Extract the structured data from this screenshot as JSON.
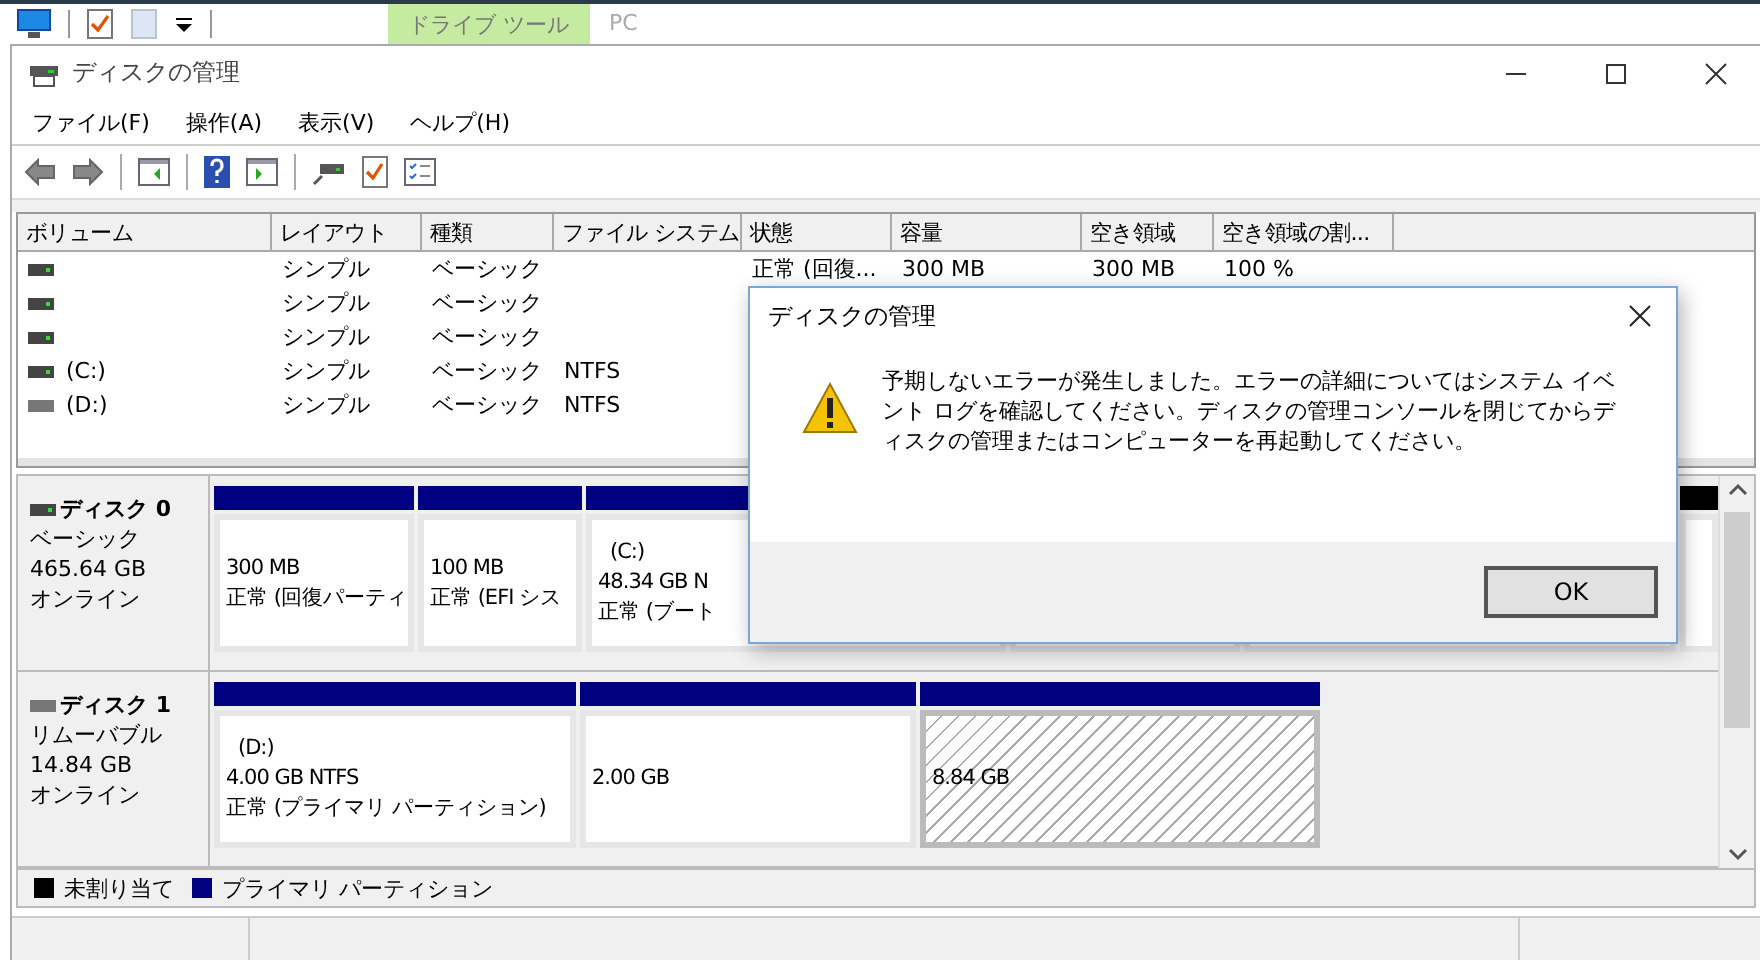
{
  "explorer_ribbon": {
    "tabs": [
      {
        "label": "ドライブ ツール",
        "selected": true
      },
      {
        "label": "PC",
        "selected": false
      }
    ]
  },
  "window": {
    "title": "ディスクの管理"
  },
  "menu": [
    "ファイル(F)",
    "操作(A)",
    "表示(V)",
    "ヘルプ(H)"
  ],
  "volume_table": {
    "columns": [
      "ボリューム",
      "レイアウト",
      "種類",
      "ファイル システム",
      "状態",
      "容量",
      "空き領域",
      "空き領域の割..."
    ],
    "rows": [
      {
        "led": true,
        "cells": [
          "",
          "シンプル",
          "ベーシック",
          "",
          "正常 (回復...",
          "300 MB",
          "300 MB",
          "100 %"
        ]
      },
      {
        "led": true,
        "cells": [
          "",
          "シンプル",
          "ベーシック"
        ]
      },
      {
        "led": true,
        "cells": [
          "",
          "シンプル",
          "ベーシック"
        ]
      },
      {
        "led": true,
        "cells": [
          "(C:)",
          "シンプル",
          "ベーシック",
          "NTFS"
        ]
      },
      {
        "led": false,
        "cells": [
          "(D:)",
          "シンプル",
          "ベーシック",
          "NTFS"
        ]
      }
    ]
  },
  "disks": [
    {
      "name": "ディスク 0",
      "led": true,
      "type": "ベーシック",
      "size": "465.64 GB",
      "status": "オンライン",
      "partitions": [
        {
          "kind": "primary",
          "selected": false,
          "size": "300 MB",
          "status": "正常 (回復パーティ"
        },
        {
          "kind": "primary",
          "selected": false,
          "size": "100 MB",
          "status": "正常 (EFI シス"
        },
        {
          "kind": "primary",
          "selected": false,
          "label": "(C:)",
          "size": "48.34 GB N",
          "status": "正常 (ブート"
        },
        {
          "selected": false
        },
        {
          "selected": false
        },
        {
          "kind": "unallocated",
          "selected": false
        }
      ]
    },
    {
      "name": "ディスク 1",
      "led": false,
      "type": "リムーバブル",
      "size": "14.84 GB",
      "status": "オンライン",
      "partitions": [
        {
          "kind": "primary",
          "selected": false,
          "label": "(D:)",
          "size": "4.00 GB NTFS",
          "status": "正常 (プライマリ パーティション)"
        },
        {
          "kind": "primary",
          "selected": false,
          "size": "2.00 GB"
        },
        {
          "kind": "primary",
          "selected": true,
          "size": "8.84 GB"
        }
      ]
    }
  ],
  "legend": [
    {
      "label": "未割り当て",
      "color": "#000000"
    },
    {
      "label": "プライマリ パーティション",
      "color": "#000080"
    }
  ],
  "dialog": {
    "title": "ディスクの管理",
    "message": "予期しないエラーが発生しました。エラーの詳細についてはシステム イベント ログを確認してください。ディスクの管理コンソールを閉じてからディスクの管理またはコンピューターを再起動してください。",
    "button": "OK"
  }
}
